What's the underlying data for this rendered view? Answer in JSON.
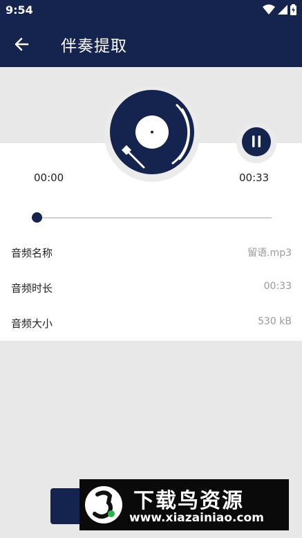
{
  "status_bar": {
    "time": "9:54"
  },
  "toolbar": {
    "title": "伴奏提取"
  },
  "player": {
    "current_time": "00:00",
    "total_time": "00:33",
    "progress": 0.0
  },
  "info_rows": [
    {
      "label": "音频名称",
      "value": "留语.mp3"
    },
    {
      "label": "音频时长",
      "value": "00:33"
    },
    {
      "label": "音频大小",
      "value": "530 kB"
    }
  ],
  "watermark": {
    "title": "下载鸟资源",
    "url": "www.xiazainiao.com"
  },
  "colors": {
    "primary": "#14244f",
    "background": "#e8e8e8",
    "card": "#ffffff"
  }
}
